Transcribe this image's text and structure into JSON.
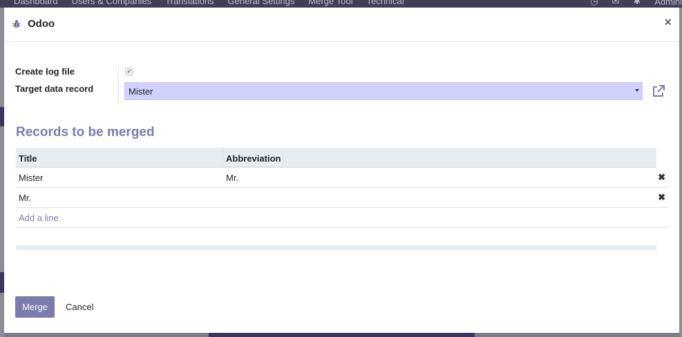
{
  "app": {
    "menu": [
      "Dashboard",
      "Users & Companies",
      "Translations",
      "General Settings",
      "Merge Tool",
      "Technical"
    ],
    "user": "Admini"
  },
  "modal": {
    "title": "Odoo",
    "close": "×"
  },
  "form": {
    "create_log_label": "Create log file",
    "create_log_checked": true,
    "target_label": "Target data record",
    "target_value": "Mister"
  },
  "records": {
    "title": "Records to be merged",
    "columns": [
      "Title",
      "Abbreviation"
    ],
    "rows": [
      {
        "title": "Mister",
        "abbreviation": "Mr."
      },
      {
        "title": "Mr.",
        "abbreviation": ""
      }
    ],
    "add_line": "Add a line"
  },
  "footer": {
    "merge": "Merge",
    "cancel": "Cancel"
  },
  "colors": {
    "accent": "#7c7bad",
    "select_bg": "#d1d1ff"
  }
}
